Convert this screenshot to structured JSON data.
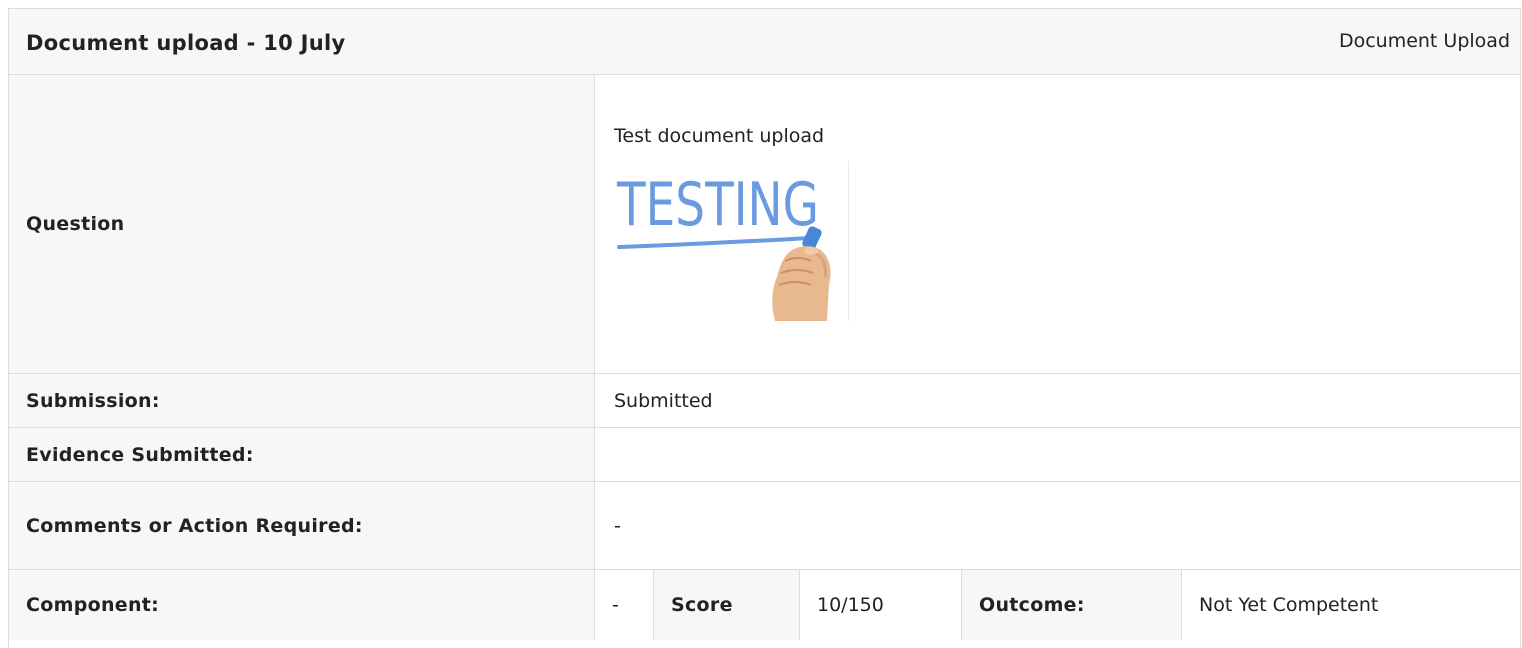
{
  "header": {
    "title": "Document upload - 10 July",
    "type_label": "Document Upload"
  },
  "rows": {
    "question": {
      "label": "Question",
      "text": "Test document upload",
      "image": {
        "description_icon": "image-icon",
        "text": "TESTING"
      }
    },
    "submission": {
      "label": "Submission:",
      "value": "Submitted"
    },
    "evidence": {
      "label": "Evidence Submitted:",
      "value": ""
    },
    "comments": {
      "label": "Comments or Action Required:",
      "value": "-"
    },
    "component": {
      "label": "Component:",
      "value": "-",
      "score_label": "Score",
      "score_value": "10/150",
      "outcome_label": "Outcome:",
      "outcome_value": "Not Yet Competent"
    }
  },
  "colors": {
    "label_bg": "#f7f7f7",
    "border": "#dcdcdc",
    "testing_text": "#6a9ae0"
  }
}
